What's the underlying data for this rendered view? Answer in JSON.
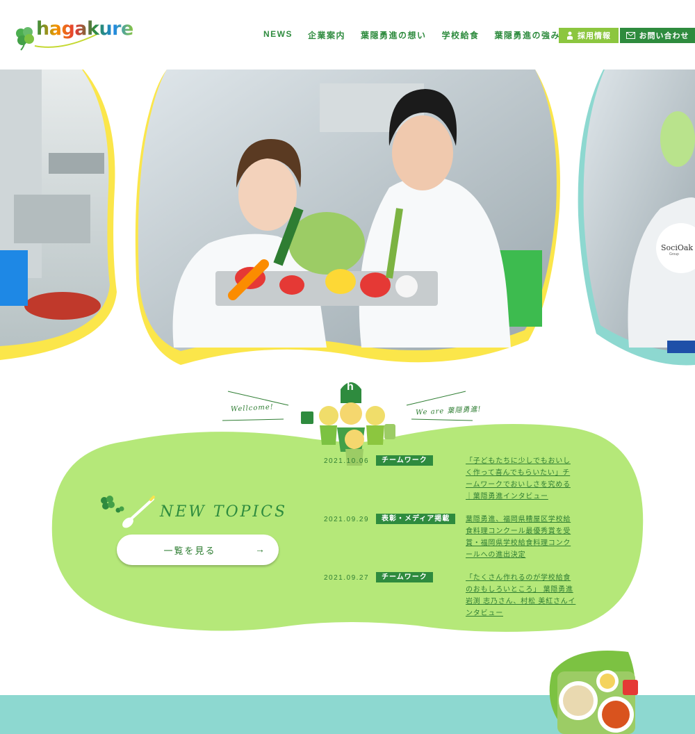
{
  "header": {
    "logo_text": "hagakure",
    "nav": [
      "NEWS",
      "企業案内",
      "葉隠勇進の想い",
      "学校給食",
      "葉隠勇進の強み"
    ],
    "recruit_label": "採用情報",
    "contact_label": "お問い合わせ"
  },
  "hero": {
    "badge_text": "SociOak",
    "badge_sub": "Group"
  },
  "welcome": {
    "left": "Wellcome!",
    "right": "We are 葉隠勇進!",
    "mascot_letter": "h"
  },
  "topics": {
    "title": "NEW TOPICS",
    "view_all_label": "一覧を見る",
    "view_all_arrow": "→",
    "items": [
      {
        "date": "2021.10.06",
        "tag": "チームワーク",
        "text": "「子どもたちに少しでもおいしく作って喜んでもらいたい」チームワークでおいしさを究める｜葉隠勇進インタビュー"
      },
      {
        "date": "2021.09.29",
        "tag": "表彰・メディア掲載",
        "text": "葉隠勇進、福岡県糟屋区学校給食料理コンクール最優秀賞を受賞・福岡県学校給食料理コンクールへの進出決定"
      },
      {
        "date": "2021.09.27",
        "tag": "チームワーク",
        "text": "「たくさん作れるのが学校給食のおもしろいところ」 葉隠勇進 岩渕 志乃さん、村松 美紅さんインタビュー"
      }
    ]
  },
  "colors": {
    "brand_green": "#2e8b3e",
    "light_green": "#8cc63f",
    "blob_green": "#b5e879",
    "hero_yellow": "#fbe64a",
    "teal": "#8dd8d0"
  }
}
